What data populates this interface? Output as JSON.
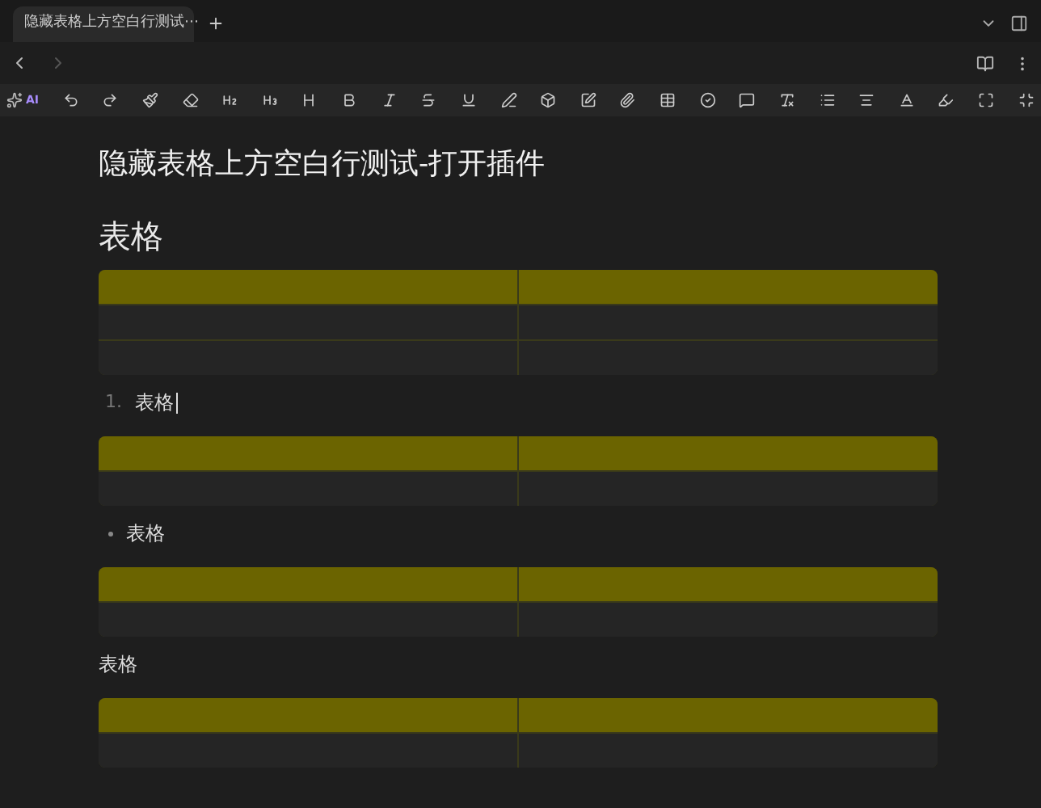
{
  "tabs": [
    {
      "label": "隐藏表格上方空白行测试⋯",
      "selected": true
    }
  ],
  "toolbar": {
    "ai_label": "AI"
  },
  "document": {
    "title": "隐藏表格上方空白行测试-打开插件",
    "blocks": [
      {
        "kind": "heading",
        "text": "表格"
      },
      {
        "kind": "table",
        "rows": [
          {
            "kind": "header"
          },
          {
            "kind": "body"
          },
          {
            "kind": "body"
          }
        ]
      },
      {
        "kind": "ordered",
        "marker": "1.",
        "text": "表格",
        "cursor": true
      },
      {
        "kind": "table",
        "rows": [
          {
            "kind": "header"
          },
          {
            "kind": "body"
          }
        ]
      },
      {
        "kind": "bullet",
        "text": "表格",
        "cursor": false
      },
      {
        "kind": "table",
        "rows": [
          {
            "kind": "header"
          },
          {
            "kind": "body"
          }
        ]
      },
      {
        "kind": "paragraph",
        "text": "表格"
      },
      {
        "kind": "table",
        "rows": [
          {
            "kind": "header"
          },
          {
            "kind": "body"
          }
        ]
      }
    ]
  }
}
